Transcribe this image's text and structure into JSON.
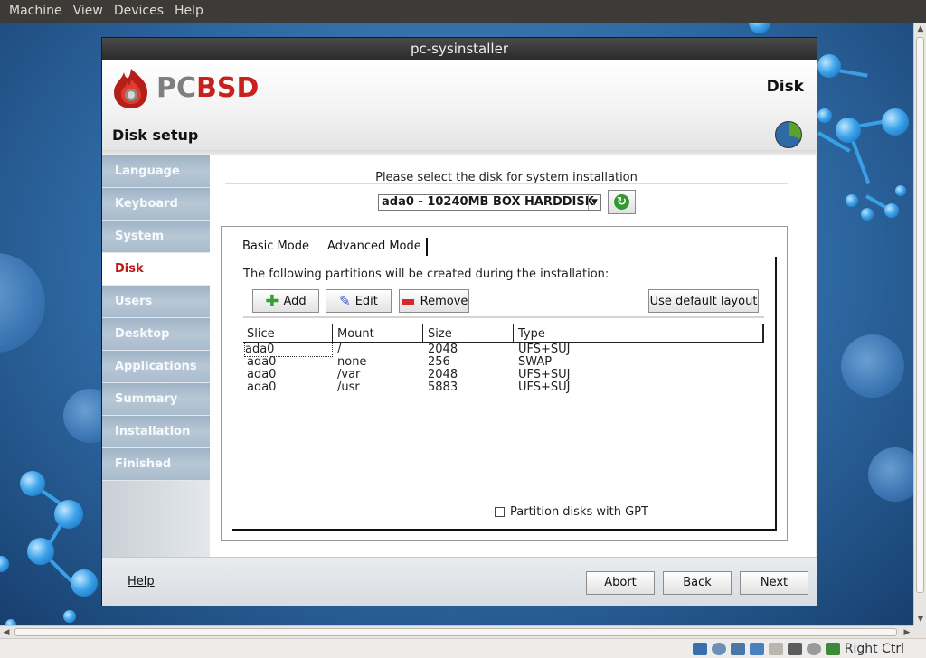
{
  "host": {
    "menu": [
      "Machine",
      "View",
      "Devices",
      "Help"
    ],
    "host_key": "Right Ctrl"
  },
  "window": {
    "title": "pc-sysinstaller"
  },
  "header": {
    "logo_pc": "PC",
    "logo_bsd": "BSD",
    "page_label": "Disk",
    "section_title": "Disk setup"
  },
  "sidebar": {
    "items": [
      {
        "label": "Language"
      },
      {
        "label": "Keyboard"
      },
      {
        "label": "System"
      },
      {
        "label": "Disk"
      },
      {
        "label": "Users"
      },
      {
        "label": "Desktop"
      },
      {
        "label": "Applications"
      },
      {
        "label": "Summary"
      },
      {
        "label": "Installation"
      },
      {
        "label": "Finished"
      }
    ],
    "active": "Disk"
  },
  "main": {
    "select_label": "Please select the disk for system installation",
    "disk_combo_value": "ada0 - 10240MB BOX HARDDISK",
    "tabs": [
      {
        "label": "Basic Mode"
      },
      {
        "label": "Advanced Mode"
      }
    ],
    "active_tab": "Advanced Mode",
    "partitions_message": "The following partitions will be created during the installation:",
    "toolbar": {
      "add_label": "Add",
      "edit_label": "Edit",
      "remove_label": "Remove",
      "default_layout_label": "Use default layout"
    },
    "table": {
      "headers": [
        "Slice",
        "Mount",
        "Size",
        "Type"
      ],
      "rows": [
        {
          "slice": "ada0",
          "mount": "/",
          "size": "2048",
          "type": "UFS+SUJ"
        },
        {
          "slice": "ada0",
          "mount": "none",
          "size": "256",
          "type": "SWAP"
        },
        {
          "slice": "ada0",
          "mount": "/var",
          "size": "2048",
          "type": "UFS+SUJ"
        },
        {
          "slice": "ada0",
          "mount": "/usr",
          "size": "5883",
          "type": "UFS+SUJ"
        }
      ]
    },
    "gpt_label": "Partition disks with GPT",
    "gpt_checked": false
  },
  "footer": {
    "help_label": "Help",
    "abort_label": "Abort",
    "back_label": "Back",
    "next_label": "Next"
  },
  "colors": {
    "active_sidebar_text": "#c01818",
    "sidebar_item_bg": "#a9bccd",
    "add_icon": "#34a02e",
    "remove_icon": "#d42a2a",
    "edit_icon": "#3b59c6"
  }
}
